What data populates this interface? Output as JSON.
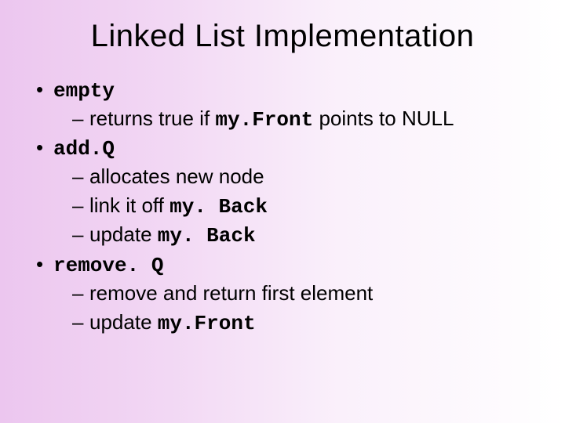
{
  "title": "Linked List Implementation",
  "items": [
    {
      "label": "empty",
      "sub": [
        {
          "pre": "returns true if ",
          "code": "my.Front",
          "post": " points to NULL"
        }
      ]
    },
    {
      "label": "add.Q",
      "sub": [
        {
          "pre": "allocates new node",
          "code": "",
          "post": ""
        },
        {
          "pre": "link it off ",
          "code": "my. Back",
          "post": ""
        },
        {
          "pre": "update ",
          "code": "my. Back",
          "post": ""
        }
      ]
    },
    {
      "label": "remove. Q",
      "sub": [
        {
          "pre": "remove and return first element",
          "code": "",
          "post": ""
        },
        {
          "pre": "update ",
          "code": "my.Front",
          "post": ""
        }
      ]
    }
  ]
}
